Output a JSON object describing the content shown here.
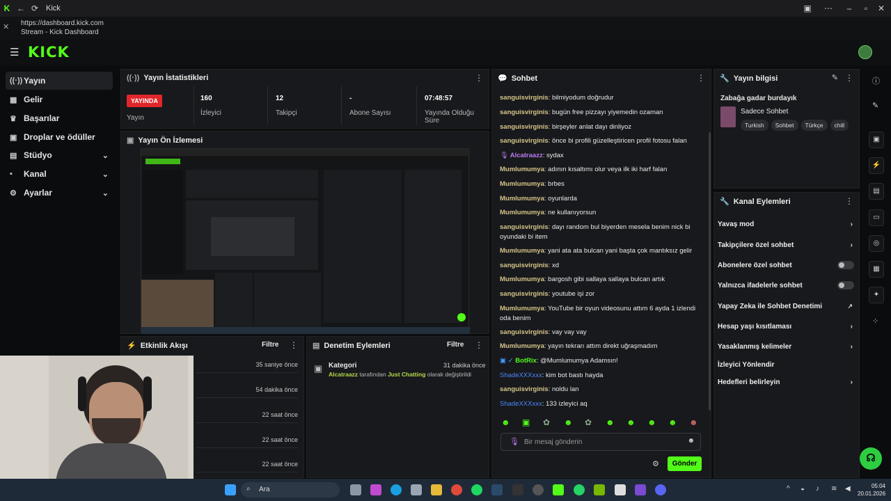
{
  "browser": {
    "tab_title": "Kick",
    "url": "https://dashboard.kick.com",
    "page_title": "Stream - Kick Dashboard"
  },
  "app": {
    "logo": "KICK"
  },
  "sidebar": {
    "items": [
      {
        "label": "Yayın",
        "icon": "broadcast-icon"
      },
      {
        "label": "Gelir",
        "icon": "revenue-icon"
      },
      {
        "label": "Başarılar",
        "icon": "trophy-icon"
      },
      {
        "label": "Droplar ve ödüller",
        "icon": "gift-icon"
      },
      {
        "label": "Stüdyo",
        "icon": "studio-icon"
      },
      {
        "label": "Kanal",
        "icon": "channel-icon"
      },
      {
        "label": "Ayarlar",
        "icon": "settings-icon"
      }
    ]
  },
  "stats": {
    "title": "Yayın İstatistikleri",
    "live_badge": "YAYINDA",
    "live_label": "Yayın",
    "viewers_value": "160",
    "viewers_label": "İzleyici",
    "followers_value": "12",
    "followers_label": "Takipçi",
    "subs_value": "-",
    "subs_label": "Abone Sayısı",
    "uptime_value": "07:48:57",
    "uptime_label": "Yayında Olduğu Süre"
  },
  "preview": {
    "title": "Yayın Ön İzlemesi"
  },
  "activity": {
    "title": "Etkinlik Akışı",
    "filter": "Filtre",
    "rows": [
      "35 saniye önce",
      "54 dakika önce",
      "22 saat önce",
      "22 saat önce",
      "22 saat önce"
    ]
  },
  "moderation": {
    "title": "Denetim Eylemleri",
    "filter": "Filtre",
    "item_title": "Kategori",
    "item_time": "31 dakika önce",
    "item_user": "Alcatraazz",
    "item_mid": " tarafından ",
    "item_value": "Just Chatting",
    "item_end": " olarak değiştirildi"
  },
  "chat": {
    "title": "Sohbet",
    "messages": [
      {
        "user": "sanguisvirginis",
        "text": "bilmiyodum doğrudur",
        "style": "g"
      },
      {
        "user": "sanguisvirginis",
        "text": "bugün free pizzayı yiyemedin ozaman",
        "style": "g"
      },
      {
        "user": "sanguisvirginis",
        "text": "birşeyler anlat dayı dinliyoz",
        "style": "g"
      },
      {
        "user": "sanguisvirginis",
        "text": "önce bi profili güzelleştiricen profil fotosu falan",
        "style": "g"
      },
      {
        "user": "Alcatraazz",
        "text": "sydax",
        "style": "p"
      },
      {
        "user": "Mumlumumya",
        "text": "adının kısaltımı olur veya ilk iki harf falan",
        "style": "g"
      },
      {
        "user": "Mumlumumya",
        "text": "brbes",
        "style": "g"
      },
      {
        "user": "Mumlumumya",
        "text": "oyunlarda",
        "style": "g"
      },
      {
        "user": "Mumlumumya",
        "text": "ne kullanıyorsun",
        "style": "g"
      },
      {
        "user": "sanguisvirginis",
        "text": "dayı random bul biyerden mesela benim nick bi oyundaki bi item",
        "style": "g"
      },
      {
        "user": "Mumlumumya",
        "text": "yani ata ata bulcan yani başta çok mantıksız gelir",
        "style": "g"
      },
      {
        "user": "sanguisvirginis",
        "text": "xd",
        "style": "g"
      },
      {
        "user": "Mumlumumya",
        "text": "bargosh gibi sallaya sallaya bulcan artık",
        "style": "g"
      },
      {
        "user": "sanguisvirginis",
        "text": "youtube işi zor",
        "style": "g"
      },
      {
        "user": "Mumlumumya",
        "text": "YouTube bir oyun videosunu attım 6 ayda 1 izlendi oda benim",
        "style": "g"
      },
      {
        "user": "sanguisvirginis",
        "text": "vay vay vay",
        "style": "g"
      },
      {
        "user": "Mumlumumya",
        "text": "yayın tekrarı attım direkt uğraşmadım",
        "style": "g"
      },
      {
        "user": "BotRix",
        "text": "@Mumlumumya Adamsın!",
        "style": "bot"
      },
      {
        "user": "ShadeXXXxxx",
        "text": "kim bot bastı hayda",
        "style": "b"
      },
      {
        "user": "sanguisvirginis",
        "text": "noldu lan",
        "style": "g"
      },
      {
        "user": "ShadeXXXxxx",
        "text": "133 izleyici aq",
        "style": "b"
      }
    ],
    "input_placeholder": "Bir mesaj gönderin",
    "send_label": "Gönder"
  },
  "stream_info": {
    "title": "Yayın bilgisi",
    "stream_title": "Zabağa gadar burdayık",
    "category": "Sadece Sohbet",
    "tags": [
      "Turkish",
      "Sohbet",
      "Türkçe",
      "chill"
    ]
  },
  "channel_actions": {
    "title": "Kanal Eylemleri",
    "items": [
      {
        "label": "Yavaş mod",
        "control": "arrow"
      },
      {
        "label": "Takipçilere özel sohbet",
        "control": "arrow"
      },
      {
        "label": "Abonelere özel sohbet",
        "control": "toggle"
      },
      {
        "label": "Yalnızca ifadelerle sohbet",
        "control": "toggle"
      },
      {
        "label": "Yapay Zeka ile Sohbet Denetimi",
        "control": "external"
      },
      {
        "label": "Hesap yaşı kısıtlaması",
        "control": "arrow"
      },
      {
        "label": "Yasaklanmış kelimeler",
        "control": "arrow"
      },
      {
        "label": "İzleyici Yönlendir",
        "control": "none"
      },
      {
        "label": "Hedefleri belirleyin",
        "control": "arrow"
      }
    ]
  },
  "taskbar": {
    "search": "Ara",
    "time": "05:04",
    "date": "20.01.2026"
  },
  "colors": {
    "accent": "#53fc18",
    "live": "#e0262b",
    "panel": "#18191c"
  }
}
